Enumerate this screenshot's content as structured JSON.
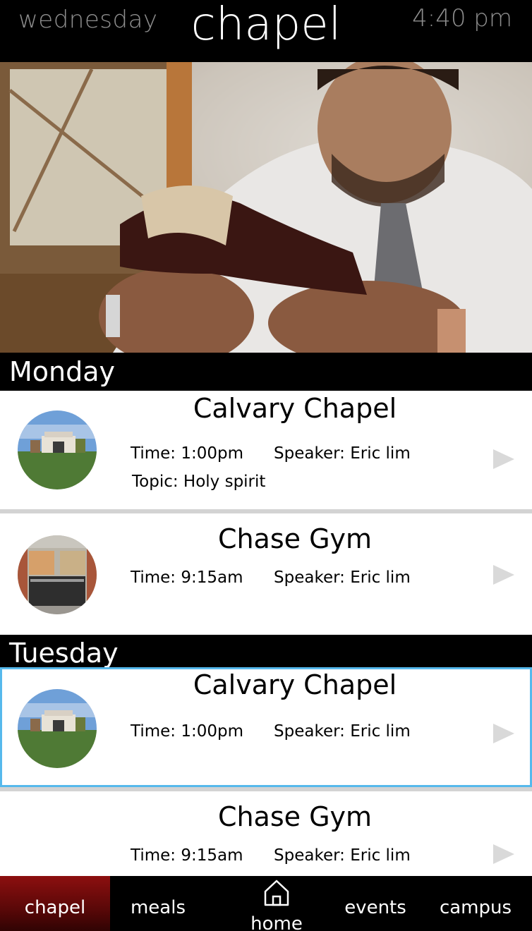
{
  "header": {
    "day": "wednesday",
    "title": "chapel",
    "time": "4:40 pm"
  },
  "hero": {
    "icon": "person-reading-bible-photo"
  },
  "days": [
    {
      "label": "Monday",
      "items": [
        {
          "title": "Calvary Chapel",
          "time": "Time: 1:00pm",
          "speaker": "Speaker: Eric lim",
          "topic": "Topic: Holy spirit",
          "thumb": "calvary-chapel-photo"
        },
        {
          "title": "Chase Gym",
          "time": "Time: 9:15am",
          "speaker": "Speaker: Eric lim",
          "thumb": "chase-gym-photo"
        }
      ]
    },
    {
      "label": "Tuesday",
      "items": [
        {
          "title": "Calvary Chapel",
          "time": "Time: 1:00pm",
          "speaker": "Speaker: Eric lim",
          "thumb": "calvary-chapel-photo"
        },
        {
          "title": "Chase Gym",
          "time": "Time: 9:15am",
          "speaker": "Speaker: Eric lim"
        }
      ]
    }
  ],
  "tabs": [
    {
      "label": "chapel",
      "active": true
    },
    {
      "label": "meals"
    },
    {
      "label": "home",
      "icon": "home-icon"
    },
    {
      "label": "events"
    },
    {
      "label": "campus"
    }
  ],
  "colors": {
    "selected_border": "#56b9ec",
    "active_tab": "#8c0f0f",
    "play_icon": "#d9d9d9"
  }
}
